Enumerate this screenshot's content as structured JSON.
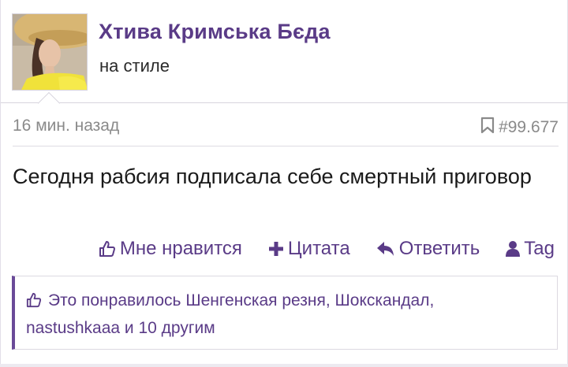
{
  "user": {
    "name": "Хтива Кримська Бєда",
    "title": "на стиле"
  },
  "post": {
    "timestamp": "16 мин. назад",
    "number": "#99.677",
    "message": "Сегодня рабсия подписала себе смертный приговор"
  },
  "actions": {
    "like": "Мне нравится",
    "quote": "Цитата",
    "reply": "Ответить",
    "tag": "Tag"
  },
  "likes": {
    "line1": "Это понравилось Шенгенская резня, Шокскандал,",
    "line2": "nastushkaaa и 10 другим"
  },
  "colors": {
    "accent": "#5a3b87",
    "muted": "#8a8a8a",
    "likes_bar": "#6a4a98"
  },
  "icons": {
    "bookmark": "bookmark-icon",
    "like": "thumbs-up-icon",
    "quote": "plus-icon",
    "reply": "reply-arrow-icon",
    "tag": "user-icon"
  }
}
